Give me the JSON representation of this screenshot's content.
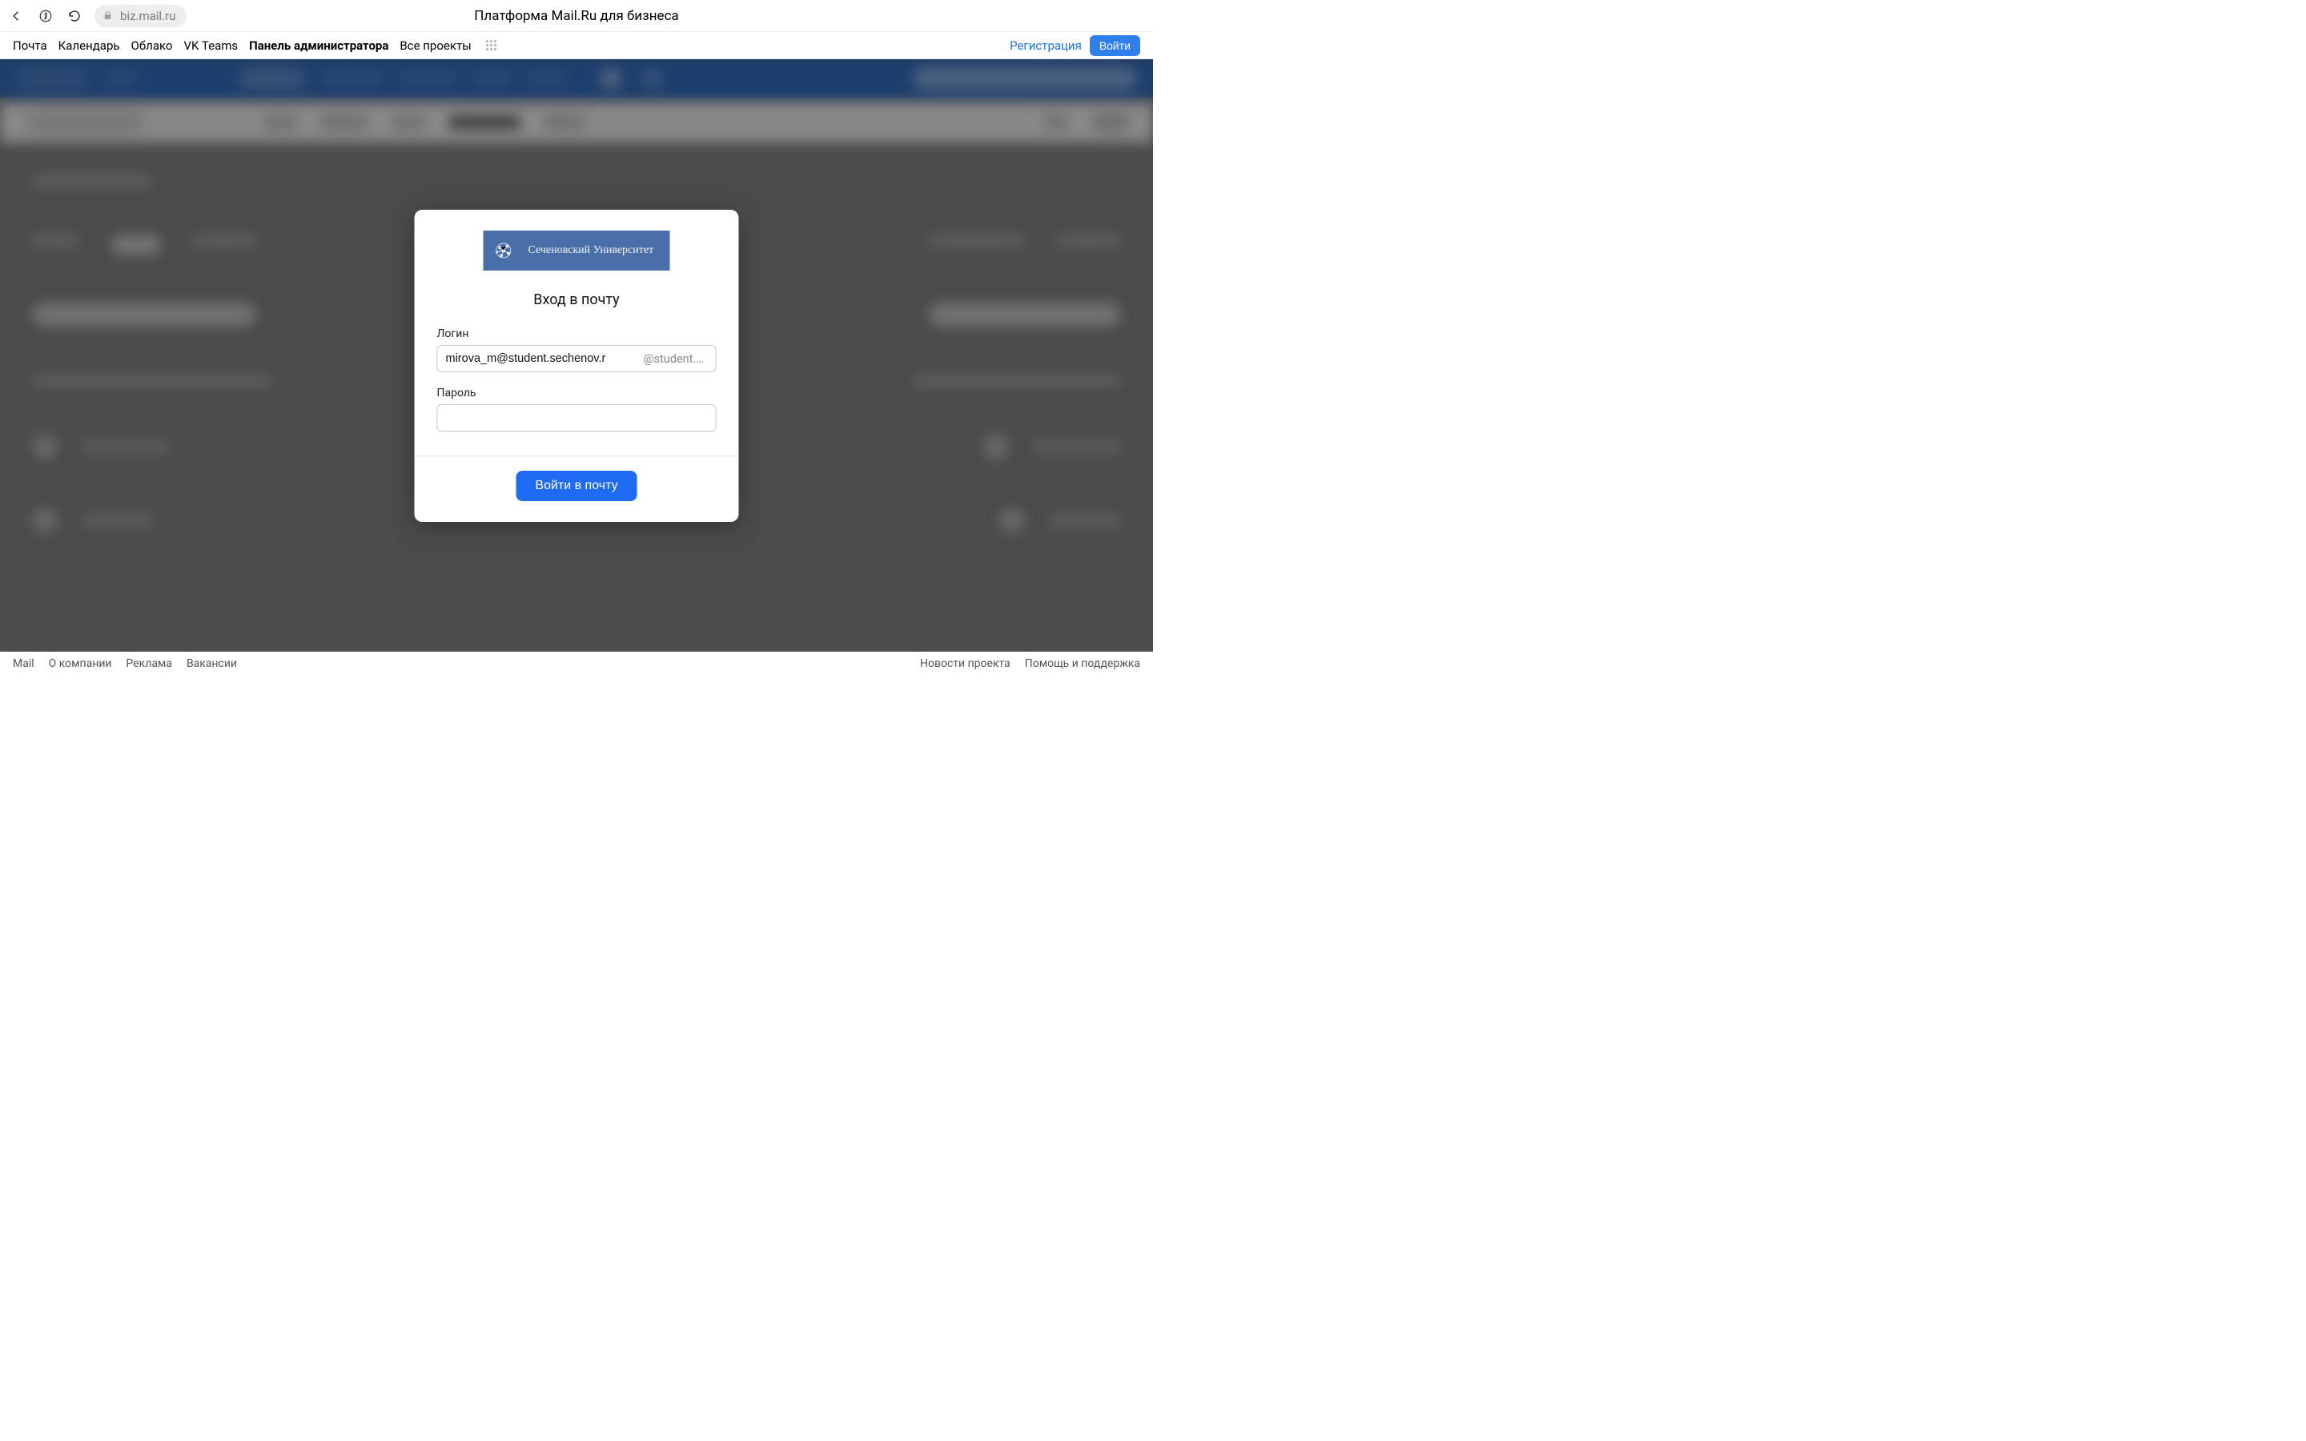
{
  "browser": {
    "url": "biz.mail.ru",
    "page_title": "Платформа Mail.Ru для бизнеса"
  },
  "nav": {
    "links": [
      "Почта",
      "Календарь",
      "Облако",
      "VK Teams",
      "Панель администратора",
      "Все проекты"
    ],
    "active_index": 4,
    "register": "Регистрация",
    "login": "Войти"
  },
  "modal": {
    "uni_name": "Сеченовский Университет",
    "title": "Вход в почту",
    "login_label": "Логин",
    "login_value": "mirova_m@student.sechenov.r",
    "domain_suffix": "@student.s…",
    "password_label": "Пароль",
    "password_value": "",
    "submit": "Войти в почту"
  },
  "footer": {
    "left": [
      "Mail",
      "О компании",
      "Реклама",
      "Вакансии"
    ],
    "right": [
      "Новости проекта",
      "Помощь и поддержка"
    ]
  }
}
